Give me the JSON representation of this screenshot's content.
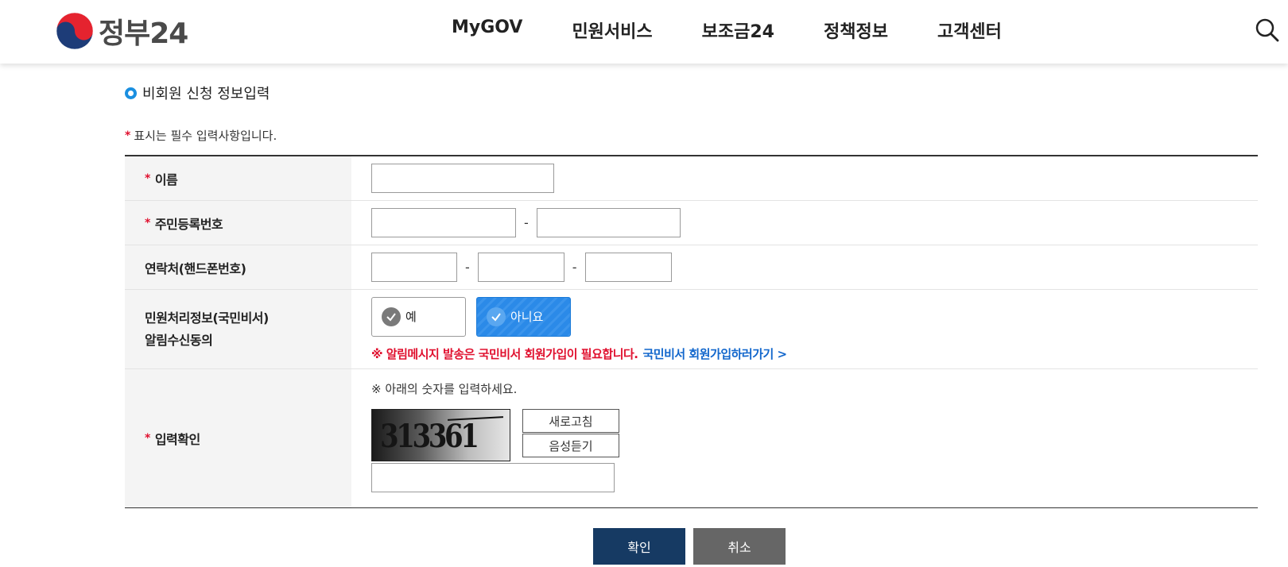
{
  "header": {
    "logo_text": "정부24",
    "nav": [
      "MyGOV",
      "민원서비스",
      "보조금24",
      "정책정보",
      "고객센터"
    ]
  },
  "form_section": {
    "title": "비회원 신청 정보입력",
    "required_note": "표시는 필수 입력사항입니다.",
    "required_mark": "*"
  },
  "fields": {
    "name_label": "이름",
    "rrn_label": "주민등록번호",
    "phone_label": "연락처(핸드폰번호)",
    "consent_label_line1": "민원처리정보(국민비서)",
    "consent_label_line2": "알림수신동의",
    "captcha_label": "입력확인",
    "dash": "-"
  },
  "consent": {
    "yes": "예",
    "no": "아니요",
    "selected": "아니요",
    "notice": "※  알림메시지 발송은 국민비서 회원가입이 필요합니다.",
    "notice_link": "국민비서 회원가입하러가기 >"
  },
  "captcha": {
    "hint": "※ 아래의 숫자를 입력하세요.",
    "code": "313361",
    "refresh": "새로고침",
    "audio": "음성듣기"
  },
  "actions": {
    "confirm": "확인",
    "cancel": "취소"
  },
  "colors": {
    "accent": "#1a8fe0",
    "required": "#e0102e",
    "link": "#1166cc",
    "confirm_bg": "#163a63",
    "cancel_bg": "#666666"
  }
}
